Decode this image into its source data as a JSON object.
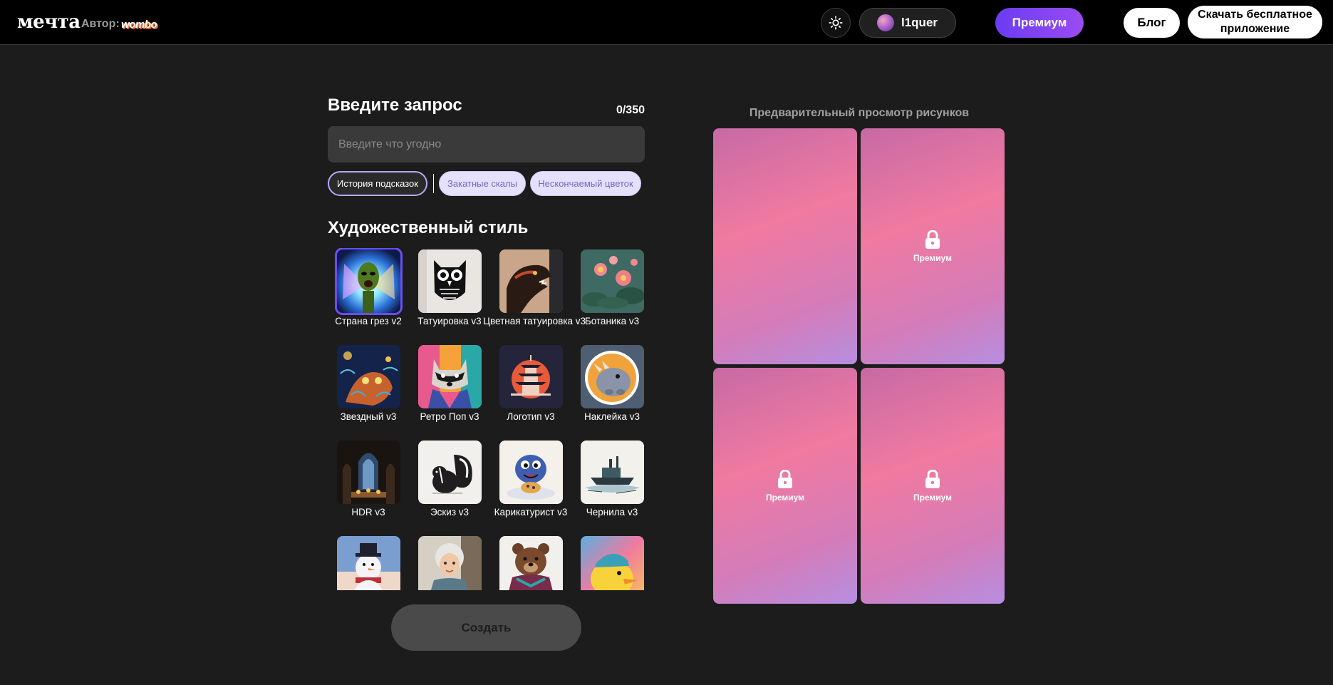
{
  "header": {
    "logo": "мечта",
    "author_label": "Автор:",
    "author_brand": "wombo",
    "user_name": "l1quer",
    "premium_label": "Премиум",
    "blog_label": "Блог",
    "download_label": "Скачать бесплатное приложение"
  },
  "prompt": {
    "title": "Введите запрос",
    "counter": "0/350",
    "placeholder": "Введите что угодно",
    "value": "",
    "history_chip": "История подсказок",
    "suggestions": [
      "Закатные скалы",
      "Нескончаемый цветок"
    ]
  },
  "styles": {
    "title": "Художественный стиль",
    "selected_index": 0,
    "items": [
      {
        "label": "Страна грез v2",
        "icon": "alien-portrait"
      },
      {
        "label": "Татуировка v3",
        "icon": "owl-tattoo"
      },
      {
        "label": "Цветная татуировка v3",
        "icon": "dinosaur-tattoo"
      },
      {
        "label": "Ботаника v3",
        "icon": "botanical-flowers"
      },
      {
        "label": "Звездный v3",
        "icon": "starry-creature"
      },
      {
        "label": "Ретро Поп v3",
        "icon": "raccoon-pop"
      },
      {
        "label": "Логотип v3",
        "icon": "pagoda-logo"
      },
      {
        "label": "Наклейка v3",
        "icon": "rhino-sticker"
      },
      {
        "label": "HDR v3",
        "icon": "cathedral-hdr"
      },
      {
        "label": "Эскиз v3",
        "icon": "skunk-sketch"
      },
      {
        "label": "Карикатурист v3",
        "icon": "creature-cartoon"
      },
      {
        "label": "Чернила v3",
        "icon": "ship-ink"
      },
      {
        "label": "",
        "icon": "snowman"
      },
      {
        "label": "",
        "icon": "grandma"
      },
      {
        "label": "",
        "icon": "bear"
      },
      {
        "label": "",
        "icon": "duck"
      }
    ]
  },
  "create_label": "Создать",
  "preview": {
    "title": "Предварительный просмотр рисунков",
    "cards": [
      {
        "locked": false,
        "label": ""
      },
      {
        "locked": true,
        "label": "Премиум"
      },
      {
        "locked": true,
        "label": "Премиум"
      },
      {
        "locked": true,
        "label": "Премиум"
      }
    ]
  },
  "colors": {
    "accent": "#6b4df2",
    "premium_gradient_start": "#6a3cf2",
    "premium_gradient_end": "#9a4cf0",
    "background": "#1c1c1c"
  }
}
